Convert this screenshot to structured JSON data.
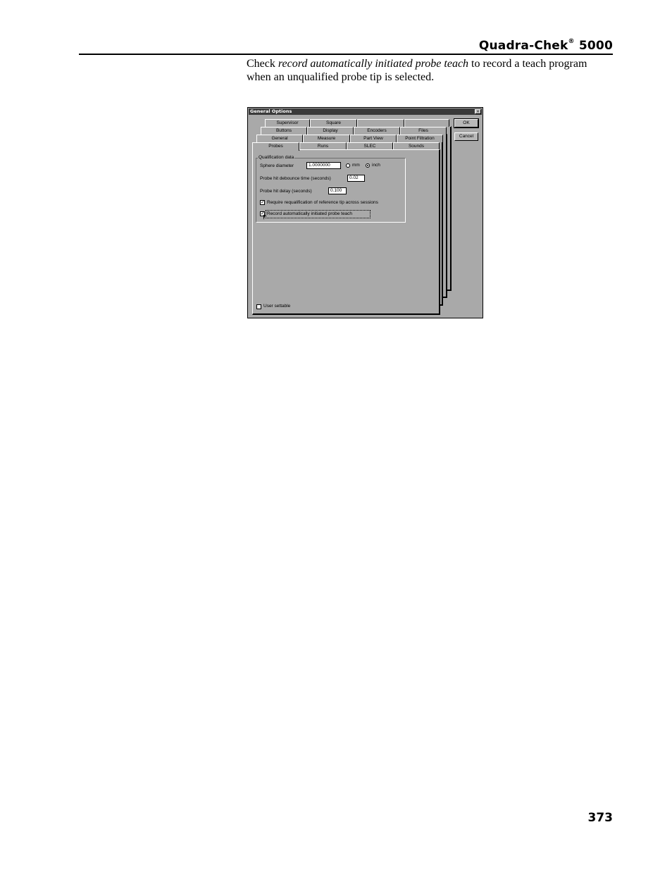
{
  "header": {
    "product_name": "Quadra-Chek",
    "registered_mark": "®",
    "model": "5000"
  },
  "body": {
    "text_before": "Check ",
    "emphasis": "record automatically initiated probe teach",
    "text_after": " to record a teach program when an unqualified probe tip is selected."
  },
  "dialog": {
    "title": "General Options",
    "close_glyph": "×",
    "ok_label": "OK",
    "cancel_label": "Cancel",
    "tab_rows": [
      [
        "Supervisor",
        "Square",
        "",
        ""
      ],
      [
        "Buttons",
        "Display",
        "Encoders",
        "Files"
      ],
      [
        "General",
        "Measure",
        "Part View",
        "Point Filtration"
      ],
      [
        "Probes",
        "Runs",
        "SLEC",
        "Sounds"
      ]
    ],
    "active_tab": "Probes",
    "group_title": "Qualification data",
    "sphere_label": "Sphere diameter",
    "sphere_value": "1.0000000",
    "unit_mm": "mm",
    "unit_inch": "inch",
    "selected_unit": "inch",
    "debounce_label": "Probe hit debounce time (seconds)",
    "debounce_value": "0.02",
    "delay_label": "Probe hit delay (seconds)",
    "delay_value": "0.100",
    "requalify_label": "Require requalification of reference tip across sessions",
    "requalify_checked": true,
    "record_label": "Record automatically initiated probe teach",
    "record_checked": true,
    "user_settable_label": "User settable",
    "user_settable_checked": false,
    "check_glyph": "✓"
  },
  "footer": {
    "page_number": "373"
  }
}
